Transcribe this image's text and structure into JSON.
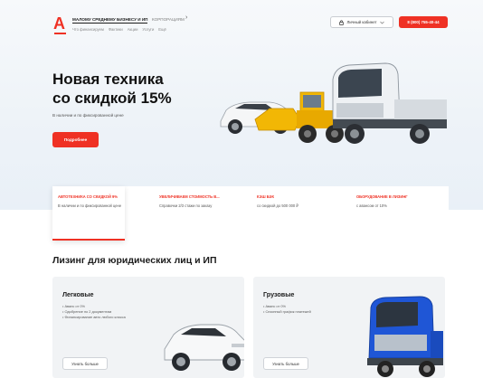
{
  "header": {
    "segment_active": "МАЛОМУ СРЕДНЕМУ БИЗНЕСУ И ИП",
    "segment_other": "КОРПОРАЦИЯМ",
    "segment_arrow": "›",
    "nav": [
      "Что финансируем",
      "Фактики",
      "Акции",
      "Услуги",
      "Ещё"
    ],
    "cabinet_label": "Личный кабинет",
    "phone_label": "8 (800) 755-40-44"
  },
  "hero": {
    "title_line1": "Новая техника",
    "title_line2": "со скидкой 15%",
    "subtitle": "В наличии и по фиксированной цене",
    "button_label": "Подробнее"
  },
  "features": [
    {
      "title": "АВТОТЕХНИКА СО СКИДКОЙ 9%",
      "desc": "В наличии и по фиксированной цене"
    },
    {
      "title": "УВЕЛИЧИВАЕМ СТОИМОСТЬ В...",
      "desc": "Справочки 2/3 стажи по заказу"
    },
    {
      "title": "КЭШ БЭК",
      "desc": "со скидкой до 500 000 ₽"
    },
    {
      "title": "ОБОРУДОВАНИЕ В ЛИЗИНГ",
      "desc": "с авансом от 10%"
    }
  ],
  "section": {
    "title": "Лизинг для юридических лиц и ИП"
  },
  "cards": [
    {
      "title": "Легковые",
      "bullets": [
        "• Аванс от 0%",
        "• Одобрение по 2 документам",
        "• Финансирование авто любого класса"
      ],
      "button_label": "Узнать больше"
    },
    {
      "title": "Грузовые",
      "bullets": [
        "• Аванс от 0%",
        "• Сезонный график платежей"
      ],
      "button_label": "Узнать больше"
    }
  ],
  "colors": {
    "brand_red": "#ef3124",
    "truck_blue": "#1f56d6",
    "card_bg": "#f1f3f5"
  },
  "icons": {
    "cabinet": "lock-icon",
    "dropdown": "chevron-down-icon"
  }
}
